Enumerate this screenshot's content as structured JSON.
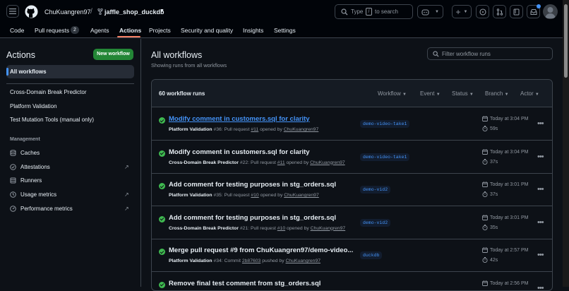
{
  "header": {
    "owner": "ChuKuangren97",
    "separator": "/",
    "repo": "jaffle_shop_duckdb",
    "search_prefix": "Type",
    "search_key": "/",
    "search_suffix": "to search"
  },
  "tabs": [
    {
      "label": "Code"
    },
    {
      "label": "Pull requests",
      "count": "2"
    },
    {
      "label": "Agents"
    },
    {
      "label": "Actions",
      "selected": true
    },
    {
      "label": "Projects"
    },
    {
      "label": "Security and quality"
    },
    {
      "label": "Insights"
    },
    {
      "label": "Settings"
    }
  ],
  "sidebar": {
    "heading": "Actions",
    "new_workflow": "New workflow",
    "all_workflows": "All workflows",
    "workflows": [
      "Cross-Domain Break Predictor",
      "Platform Validation",
      "Test Mutation Tools (manual only)"
    ],
    "management_heading": "Management",
    "management": [
      {
        "label": "Caches",
        "icon": "caches-icon"
      },
      {
        "label": "Attestations",
        "icon": "attestations-icon",
        "external": true
      },
      {
        "label": "Runners",
        "icon": "runners-icon"
      },
      {
        "label": "Usage metrics",
        "icon": "usage-metrics-icon",
        "external": true
      },
      {
        "label": "Performance metrics",
        "icon": "performance-metrics-icon",
        "external": true
      }
    ]
  },
  "main": {
    "title": "All workflows",
    "subtitle": "Showing runs from all workflows",
    "filter_placeholder": "Filter workflow runs",
    "runs_count": "60 workflow runs",
    "filters": [
      "Workflow",
      "Event",
      "Status",
      "Branch",
      "Actor"
    ]
  },
  "runs": [
    {
      "title": "Modify comment in customers.sql for clarity",
      "link": true,
      "workflow": "Platform Validation",
      "detail_pre": "#36: Pull request ",
      "ref": "#11",
      "detail_mid": " opened by ",
      "actor": "ChuKuangren97",
      "branch": "demo-video-take1",
      "when": "Today at 3:04 PM",
      "duration": "59s"
    },
    {
      "title": "Modify comment in customers.sql for clarity",
      "link": false,
      "workflow": "Cross-Domain Break Predictor",
      "detail_pre": "#22: Pull request ",
      "ref": "#11",
      "detail_mid": " opened by ",
      "actor": "ChuKuangren97",
      "branch": "demo-video-take1",
      "when": "Today at 3:04 PM",
      "duration": "37s"
    },
    {
      "title": "Add comment for testing purposes in stg_orders.sql",
      "link": false,
      "workflow": "Platform Validation",
      "detail_pre": "#35: Pull request ",
      "ref": "#10",
      "detail_mid": " opened by ",
      "actor": "ChuKuangren97",
      "branch": "demo-vid2",
      "when": "Today at 3:01 PM",
      "duration": "37s"
    },
    {
      "title": "Add comment for testing purposes in stg_orders.sql",
      "link": false,
      "workflow": "Cross-Domain Break Predictor",
      "detail_pre": "#21: Pull request ",
      "ref": "#10",
      "detail_mid": " opened by ",
      "actor": "ChuKuangren97",
      "branch": "demo-vid2",
      "when": "Today at 3:01 PM",
      "duration": "35s"
    },
    {
      "title": "Merge pull request #9 from ChuKuangren97/demo-video...",
      "link": false,
      "workflow": "Platform Validation",
      "detail_pre": "#34: Commit ",
      "ref": "2b87603",
      "detail_mid": " pushed by ",
      "actor": "ChuKuangren97",
      "branch": "duckdb",
      "when": "Today at 2:57 PM",
      "duration": "42s"
    },
    {
      "title": "Remove final test comment from stg_orders.sql",
      "link": false,
      "workflow": "",
      "detail_pre": "",
      "ref": "",
      "detail_mid": "",
      "actor": "",
      "branch": "",
      "when": "Today at 2:56 PM",
      "duration": ""
    }
  ],
  "colors": {
    "accent": "#4493f8",
    "success": "#3fb950",
    "new_button": "#238636",
    "tab_underline": "#f78166"
  }
}
